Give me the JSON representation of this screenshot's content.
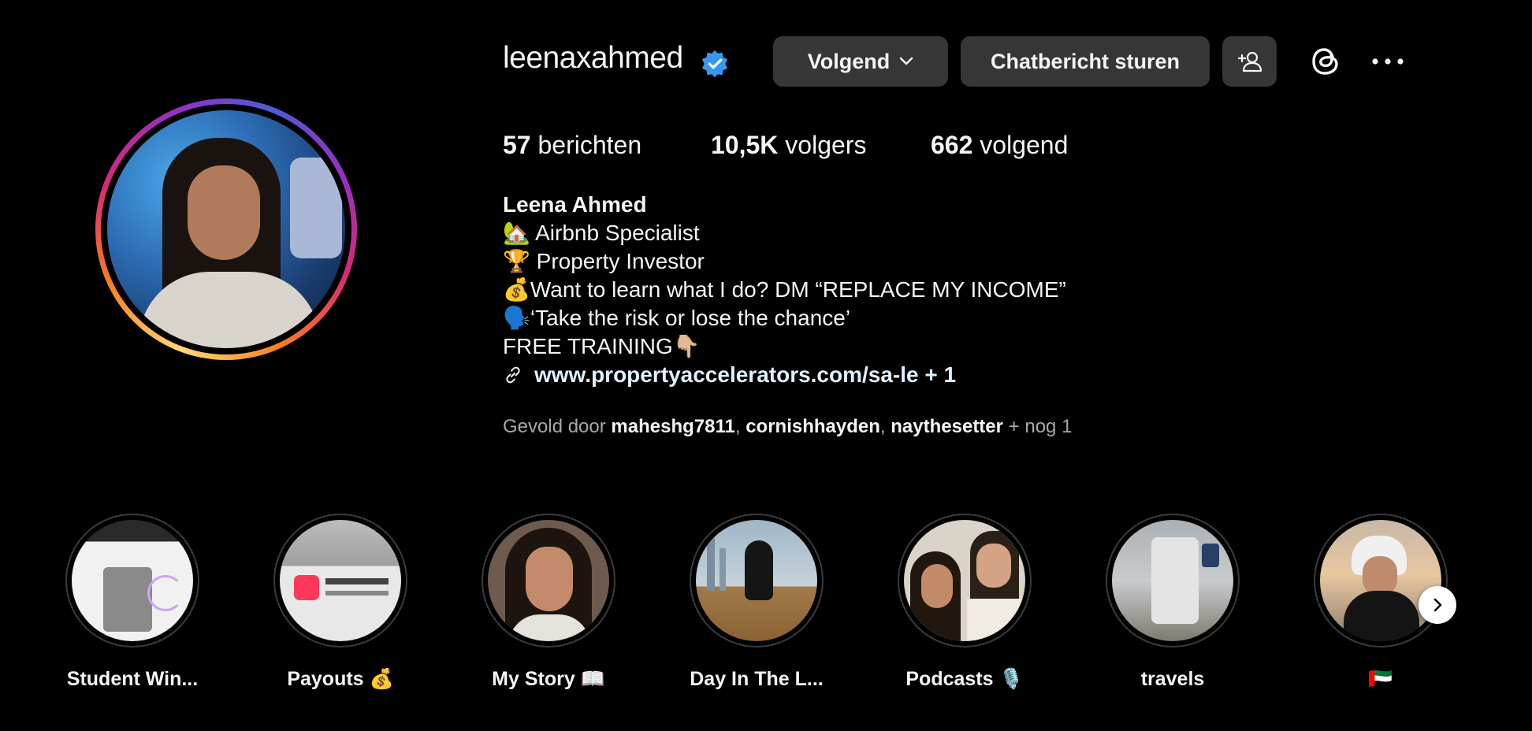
{
  "profile": {
    "username": "leenaxahmed",
    "verified": true,
    "buttons": {
      "following": "Volgend",
      "message": "Chatbericht sturen"
    },
    "stats": [
      {
        "count": "57",
        "label": "berichten"
      },
      {
        "count": "10,5K",
        "label": "volgers"
      },
      {
        "count": "662",
        "label": "volgend"
      }
    ],
    "bio": {
      "name": "Leena Ahmed",
      "lines": [
        "🏡 Airbnb Specialist",
        "🏆 Property Investor",
        "💰Want to learn what I do? DM “REPLACE MY INCOME”",
        "🗣️‘Take the risk or lose the chance’",
        "FREE TRAINING👇🏼"
      ],
      "link": "www.propertyaccelerators.com/sa-le + 1"
    },
    "followed_by": {
      "prefix": "Gevold door",
      "users": [
        "maheshg7811",
        "cornishhayden",
        "naythesetter"
      ],
      "suffix": "+ nog 1"
    }
  },
  "highlights": [
    {
      "label": "Student Win..."
    },
    {
      "label": "Payouts 💰"
    },
    {
      "label": "My Story 📖"
    },
    {
      "label": "Day In The L..."
    },
    {
      "label": "Podcasts 🎙️"
    },
    {
      "label": "travels"
    },
    {
      "label": "🇦🇪"
    }
  ],
  "colors": {
    "background": "#000000",
    "button": "#363636",
    "verified": "#0095f6",
    "muted_text": "#a8a8a8",
    "link_text": "#e0f1ff"
  },
  "icons": [
    "verified-badge-icon",
    "chevron-down-icon",
    "add-person-icon",
    "threads-icon",
    "more-options-icon",
    "link-icon",
    "chevron-right-icon"
  ]
}
